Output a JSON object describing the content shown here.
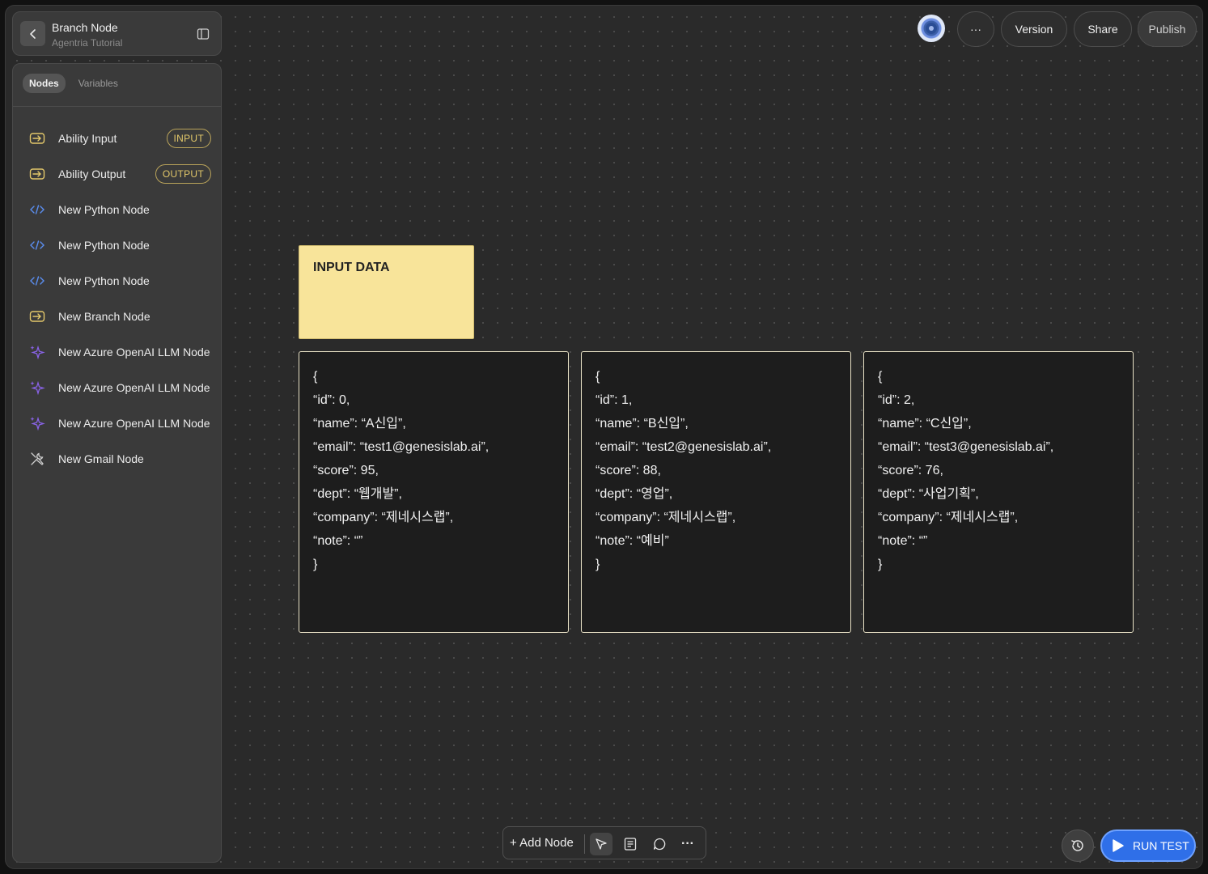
{
  "header": {
    "title": "Branch Node",
    "subtitle": "Agentria Tutorial"
  },
  "sidebar": {
    "tabs": [
      {
        "label": "Nodes"
      },
      {
        "label": "Variables"
      }
    ],
    "items": [
      {
        "label": "Ability Input",
        "badge": "INPUT",
        "icon": "login-arrow-icon"
      },
      {
        "label": "Ability Output",
        "badge": "OUTPUT",
        "icon": "login-arrow-icon"
      },
      {
        "label": "New Python Node",
        "icon": "code-icon"
      },
      {
        "label": "New Python Node",
        "icon": "code-icon"
      },
      {
        "label": "New Python Node",
        "icon": "code-icon"
      },
      {
        "label": "New Branch Node",
        "icon": "login-arrow-icon"
      },
      {
        "label": "New Azure OpenAI LLM Node",
        "icon": "sparkle-icon"
      },
      {
        "label": "New Azure OpenAI LLM Node",
        "icon": "sparkle-icon"
      },
      {
        "label": "New Azure OpenAI LLM Node",
        "icon": "sparkle-icon"
      },
      {
        "label": "New Gmail Node",
        "icon": "tools-icon"
      }
    ]
  },
  "topbar": {
    "more": "···",
    "version": "Version",
    "share": "Share",
    "publish": "Publish"
  },
  "canvas": {
    "sticky_title": "INPUT DATA",
    "cards": [
      {
        "lines": [
          "{",
          "“id”: 0,",
          "“name”: “A신입”,",
          "“email”: “test1@genesislab.ai”,",
          "“score”: 95,",
          "“dept”: “웹개발”,",
          "“company”: “제네시스랩”,",
          "“note”: “”",
          "}"
        ]
      },
      {
        "lines": [
          "{",
          "“id”: 1,",
          "“name”: “B신입”,",
          "“email”: “test2@genesislab.ai”,",
          "“score”: 88,",
          "“dept”: “영업”,",
          "“company”: “제네시스랩”,",
          "“note”: “예비”",
          "}"
        ]
      },
      {
        "lines": [
          "{",
          "“id”: 2,",
          "“name”: “C신입”,",
          "“email”: “test3@genesislab.ai”,",
          "“score”: 76,",
          "“dept”: “사업기획”,",
          "“company”: “제네시스랩”,",
          "“note”: “”",
          "}"
        ]
      }
    ]
  },
  "bottombar": {
    "add_node": "+ Add Node",
    "more": "···"
  },
  "run": {
    "label": "RUN TEST"
  },
  "colors": {
    "accent": "#2f6fe8",
    "badge": "#e3c86a",
    "sticky": "#f8e49a",
    "sparkle": "#8a63e8",
    "code": "#5a8ef0"
  }
}
